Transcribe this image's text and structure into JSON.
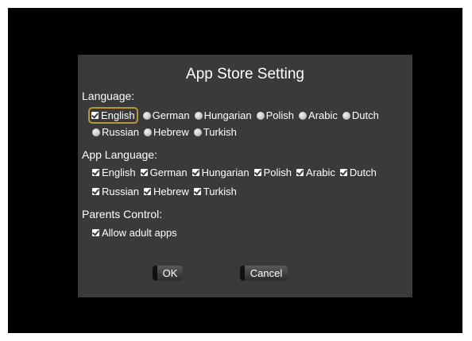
{
  "dialog": {
    "title": "App Store Setting",
    "language": {
      "label": "Language:",
      "options": [
        "English",
        "German",
        "Hungarian",
        "Polish",
        "Arabic",
        "Dutch",
        "Russian",
        "Hebrew",
        "Turkish"
      ],
      "selected": "English"
    },
    "app_language": {
      "label": "App Language:",
      "options": [
        "English",
        "German",
        "Hungarian",
        "Polish",
        "Arabic",
        "Dutch",
        "Russian",
        "Hebrew",
        "Turkish"
      ]
    },
    "parents_control": {
      "label": "Parents Control:",
      "allow_adult_apps": "Allow adult apps"
    },
    "buttons": {
      "ok": "OK",
      "cancel": "Cancel"
    }
  }
}
